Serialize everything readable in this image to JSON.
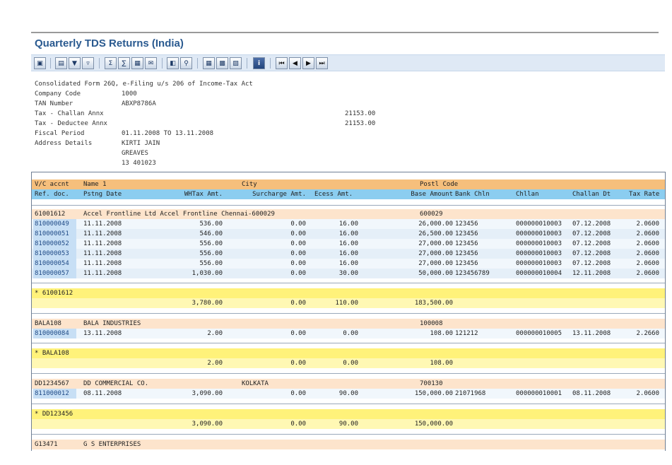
{
  "title": "Quarterly TDS Returns (India)",
  "header": {
    "line1": "Consolidated Form 26Q, e-Filing u/s 206 of Income-Tax Act",
    "company_code_label": "Company Code",
    "company_code": "1000",
    "tan_label": "TAN Number",
    "tan": "ABXP8786A",
    "challan_label": "Tax - Challan Annx",
    "challan_amount": "21153.00",
    "deductee_label": "Tax - Deductee Annx",
    "deductee_amount": "21153.00",
    "fiscal_label": "Fiscal Period",
    "fiscal_value": "01.11.2008 TO 13.11.2008",
    "address_label": "Address Details",
    "address_line1": "KIRTI JAIN",
    "address_line2": "GREAVES",
    "address_line3": "13 401023"
  },
  "columns1": {
    "vc": "V/C accnt",
    "name": "Name 1",
    "city": "City",
    "postl": "Postl Code"
  },
  "columns2": {
    "ref": "Ref. doc.",
    "date": "Pstng Date",
    "whtax": "WHTax Amt.",
    "surcharge": "Surcharge Amt.",
    "ecess": "Ecess Amt.",
    "base": "Base Amount",
    "bank": "Bank Chln",
    "chllan": "Chllan",
    "challan_dt": "Challan Dt",
    "tax_rate": "Tax Rate"
  },
  "groups": [
    {
      "vendor": {
        "vc": "61001612",
        "name": "Accel Frontline Ltd Accel Frontline Chennai-600029",
        "city": "",
        "postl": "600029"
      },
      "items": [
        {
          "ref": "810000049",
          "date": "11.11.2008",
          "whtax": "536.00",
          "surcharge": "0.00",
          "ecess": "16.00",
          "base": "26,000.00",
          "bank": "123456",
          "chllan": "000000010003",
          "challan_dt": "07.12.2008",
          "rate": "2.0600"
        },
        {
          "ref": "810000051",
          "date": "11.11.2008",
          "whtax": "546.00",
          "surcharge": "0.00",
          "ecess": "16.00",
          "base": "26,500.00",
          "bank": "123456",
          "chllan": "000000010003",
          "challan_dt": "07.12.2008",
          "rate": "2.0600"
        },
        {
          "ref": "810000052",
          "date": "11.11.2008",
          "whtax": "556.00",
          "surcharge": "0.00",
          "ecess": "16.00",
          "base": "27,000.00",
          "bank": "123456",
          "chllan": "000000010003",
          "challan_dt": "07.12.2008",
          "rate": "2.0600"
        },
        {
          "ref": "810000053",
          "date": "11.11.2008",
          "whtax": "556.00",
          "surcharge": "0.00",
          "ecess": "16.00",
          "base": "27,000.00",
          "bank": "123456",
          "chllan": "000000010003",
          "challan_dt": "07.12.2008",
          "rate": "2.0600"
        },
        {
          "ref": "810000054",
          "date": "11.11.2008",
          "whtax": "556.00",
          "surcharge": "0.00",
          "ecess": "16.00",
          "base": "27,000.00",
          "bank": "123456",
          "chllan": "000000010003",
          "challan_dt": "07.12.2008",
          "rate": "2.0600"
        },
        {
          "ref": "810000057",
          "date": "11.11.2008",
          "whtax": "1,030.00",
          "surcharge": "0.00",
          "ecess": "30.00",
          "base": "50,000.00",
          "bank": "123456789",
          "chllan": "000000010004",
          "challan_dt": "12.11.2008",
          "rate": "2.0600"
        }
      ],
      "subtotal_label": "* 61001612",
      "subtotal": {
        "whtax": "3,780.00",
        "surcharge": "0.00",
        "ecess": "110.00",
        "base": "183,500.00"
      }
    },
    {
      "vendor": {
        "vc": "BALA108",
        "name": "BALA INDUSTRIES",
        "city": "",
        "postl": "100008"
      },
      "items": [
        {
          "ref": "810000084",
          "date": "13.11.2008",
          "whtax": "2.00",
          "surcharge": "0.00",
          "ecess": "0.00",
          "base": "108.00",
          "bank": "121212",
          "chllan": "000000010005",
          "challan_dt": "13.11.2008",
          "rate": "2.2660"
        }
      ],
      "subtotal_label": "* BALA108",
      "subtotal": {
        "whtax": "2.00",
        "surcharge": "0.00",
        "ecess": "0.00",
        "base": "108.00"
      }
    },
    {
      "vendor": {
        "vc": "DD1234567",
        "name": "DD COMMERCIAL CO.",
        "city": "KOLKATA",
        "postl": "700130"
      },
      "items": [
        {
          "ref": "811000012",
          "date": "08.11.2008",
          "whtax": "3,090.00",
          "surcharge": "0.00",
          "ecess": "90.00",
          "base": "150,000.00",
          "bank": "21071968",
          "chllan": "000000010001",
          "challan_dt": "08.11.2008",
          "rate": "2.0600"
        }
      ],
      "subtotal_label": "* DD123456",
      "subtotal": {
        "whtax": "3,090.00",
        "surcharge": "0.00",
        "ecess": "90.00",
        "base": "150,000.00"
      }
    },
    {
      "vendor": {
        "vc": "G13471",
        "name": "G S ENTERPRISES",
        "city": "",
        "postl": ""
      },
      "items": [],
      "subtotal_label": "",
      "subtotal": null
    }
  ],
  "toolbar_icons": [
    "details-icon",
    "print-icon",
    "filter-icon",
    "filter-set-icon",
    "sum-icon",
    "subtotal-icon",
    "export-icon",
    "mail-icon",
    "print-preview-icon",
    "find-icon",
    "layout-icon",
    "choose-layout-icon",
    "save-layout-icon",
    "info-icon",
    "first-page-icon",
    "previous-page-icon",
    "next-page-icon",
    "last-page-icon"
  ],
  "colors": {
    "title": "#2a5a90",
    "col_header_1": "#f6bf7c",
    "col_header_2": "#8bcdf0",
    "vendor_row": "#fde4cc",
    "subtotal_row": "#fff27a"
  }
}
